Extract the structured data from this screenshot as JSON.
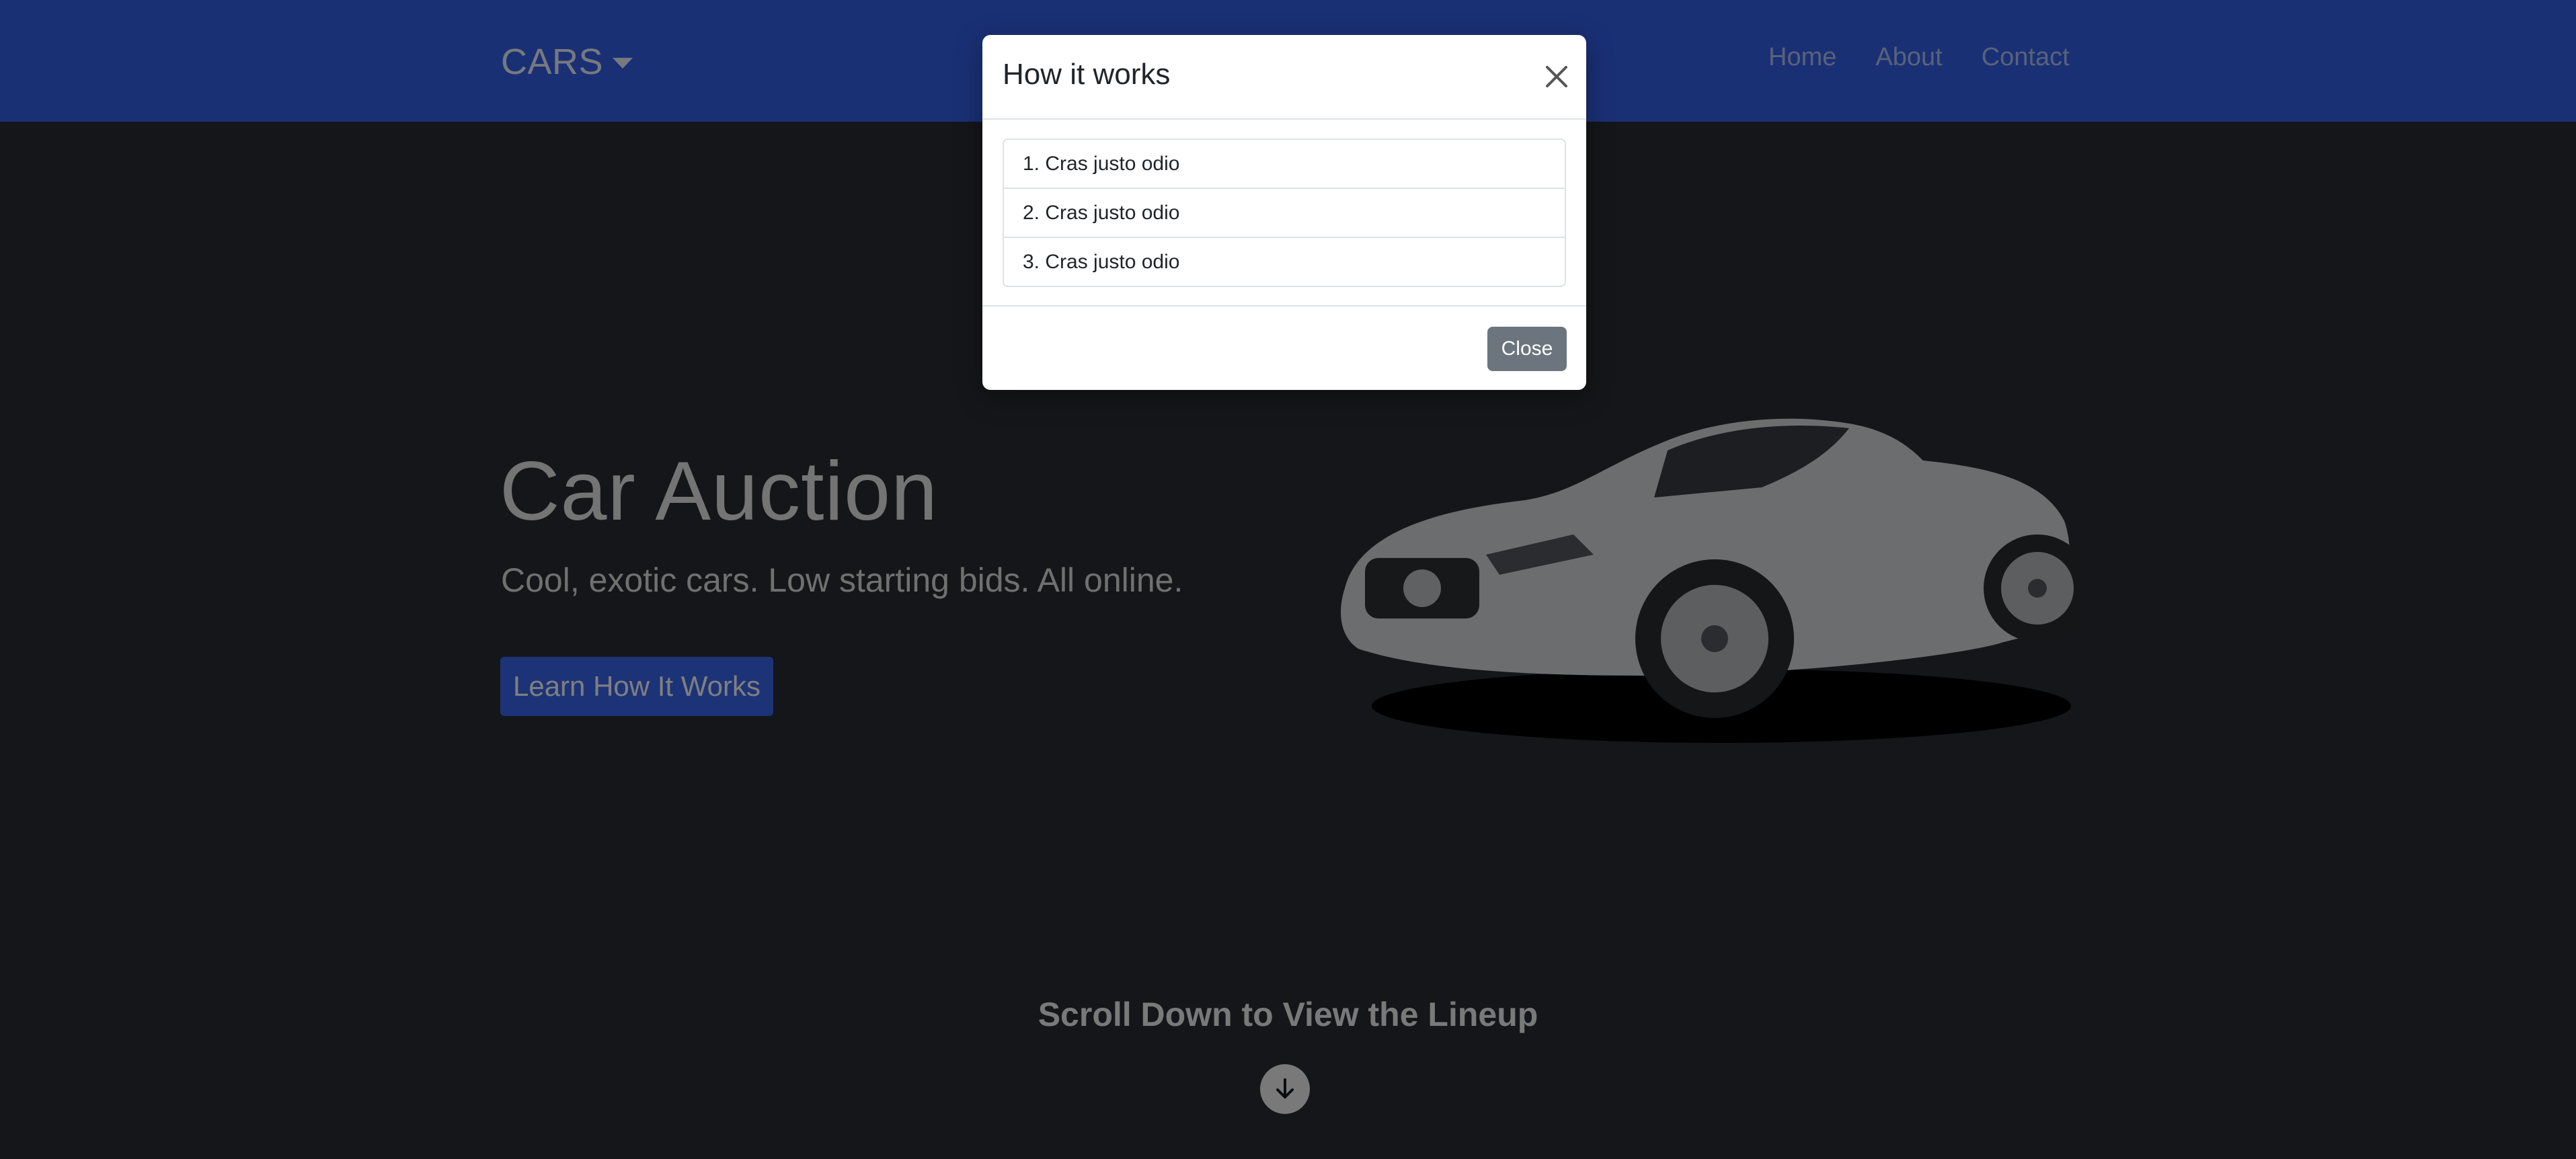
{
  "navbar": {
    "brand": "CARS",
    "links": [
      "Home",
      "About",
      "Contact"
    ]
  },
  "hero": {
    "title": "Car Auction",
    "subtitle": "Cool, exotic cars. Low starting bids. All online.",
    "cta_label": "Learn How It Works",
    "scroll_text": "Scroll Down to View the Lineup"
  },
  "modal": {
    "title": "How it works",
    "items": [
      "1. Cras justo odio",
      "2. Cras justo odio",
      "3. Cras justo odio"
    ],
    "close_label": "Close"
  },
  "colors": {
    "navbar": "#3560ea",
    "hero_background": "#2a2d33",
    "cta": "#3a66f0",
    "close_button": "#6c757d"
  },
  "icons": {
    "brand_caret": "caret-down-icon",
    "modal_close": "close-icon",
    "scroll": "arrow-down-circle-icon"
  }
}
